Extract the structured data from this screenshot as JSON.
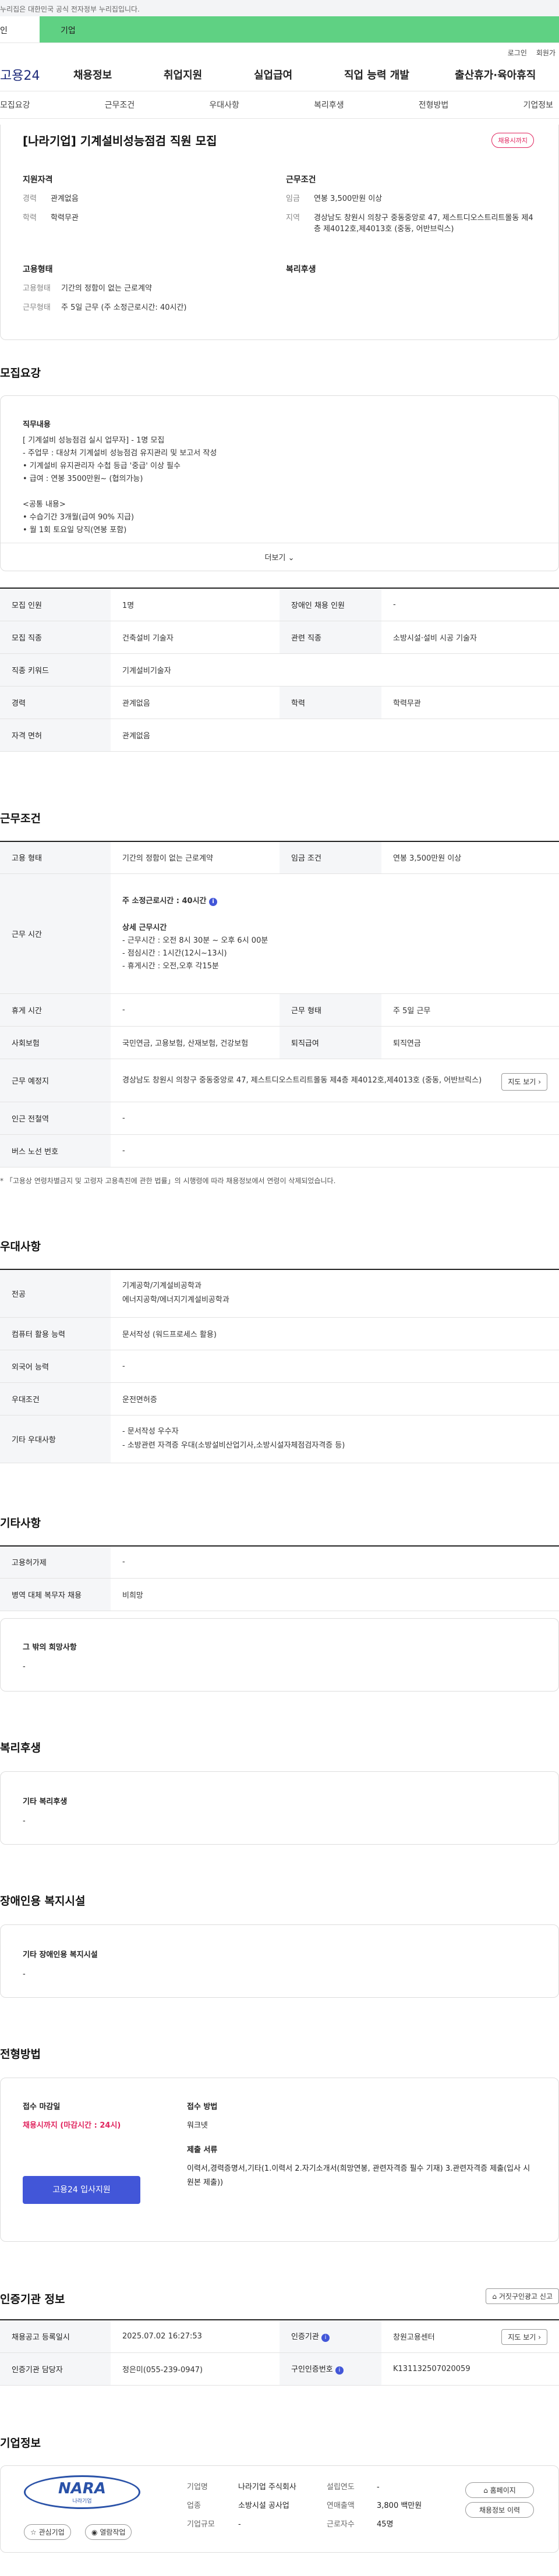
{
  "ribbon": "누리집은 대한민국 공식 전자정부 누리집입니다.",
  "user_tabs": [
    "인",
    "기업"
  ],
  "util": [
    "로그인",
    "회원가"
  ],
  "gnb": {
    "logo": "고용24",
    "menu": [
      "채용정보",
      "취업지원",
      "실업급여",
      "직업 능력 개발",
      "출산휴가·육아휴직"
    ]
  },
  "tabs": [
    "모집요강",
    "근무조건",
    "우대사항",
    "복리후생",
    "전형방법",
    "기업정보"
  ],
  "header": {
    "title": "[나라기업] 기계설비성능점검 직원 모집",
    "badge": "채용시까지",
    "qual_title": "지원자격",
    "qual": [
      {
        "k": "경력",
        "v": "관계없음"
      },
      {
        "k": "학력",
        "v": "학력무관"
      }
    ],
    "cond_title": "근무조건",
    "cond": [
      {
        "k": "임금",
        "v": "연봉 3,500만원 이상"
      },
      {
        "k": "지역",
        "v": "경상남도 창원시 의창구 중동중앙로 47, 제스트디오스트리트몰동 제4층 제4012호,제4013호 (중동, 어반브릭스)"
      }
    ],
    "emp_title": "고용형태",
    "emp": [
      {
        "k": "고용형태",
        "v": "기간의 정함이 없는 근로계약"
      },
      {
        "k": "근무형태",
        "v": "주 5일 근무 (주 소정근로시간: 40시간)"
      }
    ],
    "welfare_title": "복리후생"
  },
  "recruit": {
    "title": "모집요강",
    "duty_label": "직무내용",
    "duty_lines": [
      "[ 기계설비 성능점검 실시 업무자] - 1명 모집",
      "- 주업무 : 대상처 기계설비 성능점검 유지관리 및 보고서 작성",
      "• 기계설비 유지관리자 수첩 등급 '중급' 이상 필수",
      "• 급여 :  연봉 3500만원~ (협의가능)",
      "",
      "<공통 내용>",
      "• 수습기간 3개월(급여 90% 지급)",
      "• 월 1회 토요일 당직(연봉 포함)"
    ],
    "more": "더보기",
    "rows": [
      [
        {
          "k": "모집 인원",
          "v": "1명"
        },
        {
          "k": "장애인 채용 인원",
          "v": "-"
        }
      ],
      [
        {
          "k": "모집 직종",
          "v": "건축설비 기술자"
        },
        {
          "k": "관련 직종",
          "v": "소방시설·설비 시공 기술자"
        }
      ],
      [
        {
          "k": "직종 키워드",
          "v": "기계설비기술자"
        }
      ],
      [
        {
          "k": "경력",
          "v": "관계없음"
        },
        {
          "k": "학력",
          "v": "학력무관"
        }
      ],
      [
        {
          "k": "자격 면허",
          "v": "관계없음"
        }
      ]
    ]
  },
  "work": {
    "title": "근무조건",
    "emp_type_k": "고용 형태",
    "emp_type_v": "기간의 정함이 없는 근로계약",
    "wage_k": "임금 조건",
    "wage_v": "연봉 3,500만원 이상",
    "hours_k": "근무 시간",
    "hours_main": "주 소정근로시간 : 40시간",
    "hours_detail_title": "상세 근무시간",
    "hours_detail": [
      "- 근무시간 : 오전 8시 30분 ~ 오후 6시 00분",
      "- 점심시간 : 1시간(12시~13시)",
      "- 휴게시간 : 오전,오후 각15분"
    ],
    "holiday_k": "휴게 시간",
    "holiday_v": "-",
    "form_k": "근무 형태",
    "form_v": "주 5일 근무",
    "ins_k": "사회보험",
    "ins_v": "국민연금, 고용보험, 산재보험, 건강보험",
    "sev_k": "퇴직급여",
    "sev_v": "퇴직연금",
    "loc_k": "근무 예정지",
    "loc_v": "경상남도 창원시 의창구 중동중앙로 47, 제스트디오스트리트몰동 제4층 제4012호,제4013호 (중동, 어반브릭스)",
    "map_btn": "지도 보기",
    "subway_k": "인근 전철역",
    "subway_v": "-",
    "bus_k": "버스 노선 번호",
    "bus_v": "-",
    "note": "* 「고용상 연령차별금지 및 고령자 고용촉진에 관한 법률」의 시행령에 따라 채용정보에서 연령이 삭제되었습니다."
  },
  "pref": {
    "title": "우대사항",
    "major_k": "전공",
    "major_v": [
      "기계공학/기계설비공학과",
      "에너지공학/에너지기계설비공학과"
    ],
    "pc_k": "컴퓨터 활용 능력",
    "pc_v": "문서작성 (워드프로세스 활용)",
    "lang_k": "외국어 능력",
    "lang_v": "-",
    "cond_k": "우대조건",
    "cond_v": "운전면허증",
    "etc_k": "기타 우대사항",
    "etc_v": [
      "- 문서작성 우수자",
      "- 소방관련 자격증 우대(소방설비산업기사,소방시설자체점검자격증 등)"
    ]
  },
  "other": {
    "title": "기타사항",
    "ins_k": "고용허가제",
    "ins_v": "-",
    "mil_k": "병역 대체 복무자 채용",
    "mil_v": "비희망",
    "wish_title": "그 밖의 희망사항",
    "wish_v": "-"
  },
  "welfare": {
    "title": "복리후생",
    "label": "기타 복리후생",
    "v": "-"
  },
  "disabled": {
    "title": "장애인용 복지시설",
    "label": "기타 장애인용 복지시설",
    "v": "-"
  },
  "process": {
    "title": "전형방법",
    "deadline_label": "접수 마감일",
    "deadline_v": "채용시까지 (마감시간 : 24시)",
    "apply_btn": "고용24 입사지원",
    "method_label": "접수 방법",
    "method_v": "워크넷",
    "docs_label": "제출 서류",
    "docs_v": "이력서,경력증명서,기타(1.이력서 2.자기소개서(희망연봉, 관련자격증 필수 기재) 3.관련자격증 제출(입사 시 원본 제출))"
  },
  "auth": {
    "title": "인증기관 정보",
    "report_btn": "거짓구인광고 신고",
    "reg_k": "채용공고 등록일시",
    "reg_v": "2025.07.02 16:27:53",
    "org_k": "인증기관",
    "org_v": "창원고용센터",
    "map_btn": "지도 보기",
    "mgr_k": "인증기관 담당자",
    "mgr_v": "정은미(055-239-0947)",
    "num_k": "구인인증번호",
    "num_v": "K131132507020059"
  },
  "company": {
    "title": "기업정보",
    "logo_text": "NARA",
    "logo_sub": "나라기업",
    "fav_btn": "관심기업",
    "follow_btn": "열람작업",
    "name_k": "기업명",
    "name_v": "나라기업 주식회사",
    "ind_k": "업종",
    "ind_v": "소방시설 공사업",
    "size_k": "기업규모",
    "size_v": "-",
    "year_k": "설립연도",
    "year_v": "-",
    "sales_k": "연매출액",
    "sales_v": "3,800 백만원",
    "emp_k": "근로자수",
    "emp_v": "45명",
    "home_btn": "홈페이지",
    "info_btn": "채용정보 이력"
  },
  "colors": {
    "accent": "#4256d8",
    "badge": "#e0245e",
    "green": "#5fd183"
  }
}
